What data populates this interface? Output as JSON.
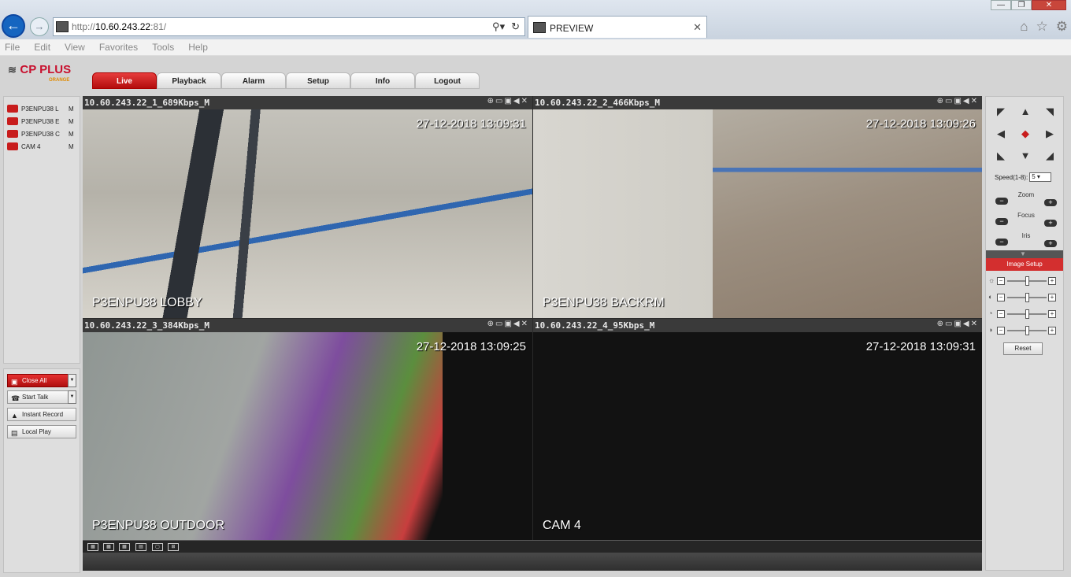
{
  "browser": {
    "url_prefix": "http://",
    "url_host": "10.60.243.22",
    "url_suffix": ":81/",
    "tab_title": "PREVIEW",
    "menu": [
      "File",
      "Edit",
      "View",
      "Favorites",
      "Tools",
      "Help"
    ]
  },
  "app": {
    "logo_text": "CP PLUS",
    "logo_sub": "ORANGE",
    "nav": [
      {
        "label": "Live",
        "active": true
      },
      {
        "label": "Playback"
      },
      {
        "label": "Alarm"
      },
      {
        "label": "Setup"
      },
      {
        "label": "Info"
      },
      {
        "label": "Logout"
      }
    ]
  },
  "cameras": [
    {
      "label": "P3ENPU38 L",
      "stream": "M"
    },
    {
      "label": "P3ENPU38 E",
      "stream": "M"
    },
    {
      "label": "P3ENPU38 C",
      "stream": "M"
    },
    {
      "label": "CAM 4",
      "stream": "M"
    }
  ],
  "controls": {
    "close_all": "Close All",
    "start_talk": "Start Talk",
    "instant_record": "Instant Record",
    "local_play": "Local Play"
  },
  "tiles": [
    {
      "title": "10.60.243.22_1_689Kbps_M",
      "timestamp": "27-12-2018 13:09:31",
      "name": "P3ENPU38 LOBBY"
    },
    {
      "title": "10.60.243.22_2_466Kbps_M",
      "timestamp": "27-12-2018 13:09:26",
      "name": "P3ENPU38 BACKRM"
    },
    {
      "title": "10.60.243.22_3_384Kbps_M",
      "timestamp": "27-12-2018 13:09:25",
      "name": "P3ENPU38 OUTDOOR"
    },
    {
      "title": "10.60.243.22_4_95Kbps_M",
      "timestamp": "27-12-2018 13:09:31",
      "name": "CAM 4"
    }
  ],
  "ptz": {
    "speed_label": "Speed(1-8):",
    "speed_value": "5",
    "zoom": "Zoom",
    "focus": "Focus",
    "iris": "Iris",
    "image_setup": "Image Setup",
    "reset": "Reset"
  },
  "colors": {
    "accent_red": "#d32f2f",
    "selected_outline": "#33cc33"
  }
}
